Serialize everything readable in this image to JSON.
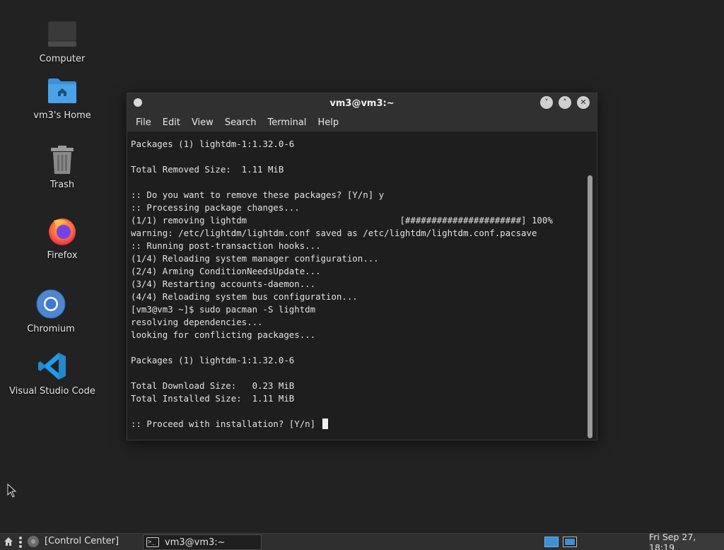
{
  "desktop": {
    "icons": [
      {
        "label": "Computer"
      },
      {
        "label": "vm3's Home"
      },
      {
        "label": "Trash"
      },
      {
        "label": "Firefox"
      },
      {
        "label": "Chromium"
      },
      {
        "label": "Visual Studio Code"
      }
    ]
  },
  "window": {
    "title": "vm3@vm3:~",
    "menu": [
      "File",
      "Edit",
      "View",
      "Search",
      "Terminal",
      "Help"
    ],
    "terminal_output": "Packages (1) lightdm-1:1.32.0-6\n\nTotal Removed Size:  1.11 MiB\n\n:: Do you want to remove these packages? [Y/n] y\n:: Processing package changes...\n(1/1) removing lightdm                             [######################] 100%\nwarning: /etc/lightdm/lightdm.conf saved as /etc/lightdm/lightdm.conf.pacsave\n:: Running post-transaction hooks...\n(1/4) Reloading system manager configuration...\n(2/4) Arming ConditionNeedsUpdate...\n(3/4) Restarting accounts-daemon...\n(4/4) Reloading system bus configuration...\n[vm3@vm3 ~]$ sudo pacman -S lightdm\nresolving dependencies...\nlooking for conflicting packages...\n\nPackages (1) lightdm-1:1.32.0-6\n\nTotal Download Size:   0.23 MiB\nTotal Installed Size:  1.11 MiB\n\n:: Proceed with installation? [Y/n] ",
    "buttons": {
      "minimize": "˅",
      "maximize": "˄",
      "close": "✕"
    }
  },
  "taskbar": {
    "control_center": "[Control Center]",
    "task_label": "vm3@vm3:~",
    "task_icon_text": ">_",
    "clock": "Fri Sep 27, 18:19"
  },
  "colors": {
    "desktop_bg": "#222222",
    "terminal_bg": "#1e1e1e",
    "folder_blue": "#3d8fd6",
    "vscode_blue": "#2489ca",
    "workspace_active": "#3d8fd6"
  }
}
